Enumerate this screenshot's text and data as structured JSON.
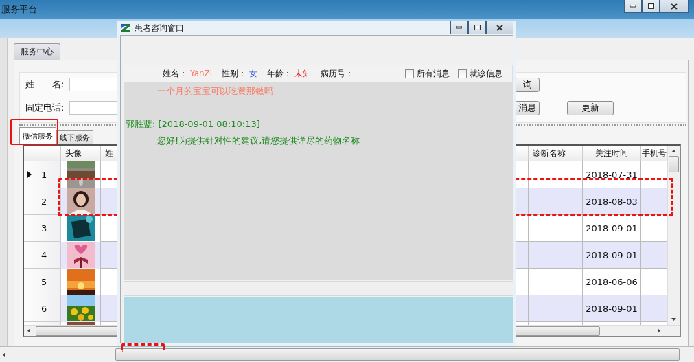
{
  "main_window": {
    "title": "服务平台"
  },
  "top_tabs": [
    {
      "label": "服务中心",
      "selected": true
    }
  ],
  "form": {
    "fields": [
      {
        "label": "姓　　名:"
      },
      {
        "label": "固定电话:"
      }
    ],
    "buttons": [
      {
        "label": "询"
      },
      {
        "label": "消息"
      },
      {
        "label": "更新"
      }
    ]
  },
  "sub_tabs": [
    {
      "label": "微信服务",
      "selected": true
    },
    {
      "label": "线下服务",
      "selected": false
    }
  ],
  "table": {
    "columns": [
      "头像",
      "姓",
      "诊断名称",
      "关注时间",
      "手机号"
    ],
    "rows": [
      {
        "number": "1",
        "current": true,
        "follow_time": "2018-07-31"
      },
      {
        "number": "2",
        "current": false,
        "follow_time": "2018-08-03"
      },
      {
        "number": "3",
        "current": false,
        "follow_time": "2018-09-01"
      },
      {
        "number": "4",
        "current": false,
        "follow_time": "2018-09-01"
      },
      {
        "number": "5",
        "current": false,
        "follow_time": "2018-06-06"
      },
      {
        "number": "6",
        "current": false,
        "follow_time": "2018-09-01"
      }
    ]
  },
  "dialog": {
    "title": "患者咨询窗口",
    "patient": [
      {
        "label": "姓名：",
        "value": "YanZi",
        "color": "#fa7a62"
      },
      {
        "label": "性别：",
        "value": "女",
        "color": "#4466dd"
      },
      {
        "label": "年龄：",
        "value": "未知",
        "color": "#ee1111"
      },
      {
        "label": "病历号："
      }
    ],
    "filters": [
      {
        "label": "所有消息",
        "checked": false
      },
      {
        "label": "就诊信息",
        "checked": false
      }
    ],
    "messages": [
      {
        "kind": "patient",
        "text": "一个月的宝宝可以吃黄那敏吗"
      },
      {
        "kind": "doctor",
        "header": "郭胜蓝: [2018-09-01 08:10:13]",
        "text": "您好!为提供针对性的建议,请您提供详尽的药物名称"
      }
    ]
  }
}
